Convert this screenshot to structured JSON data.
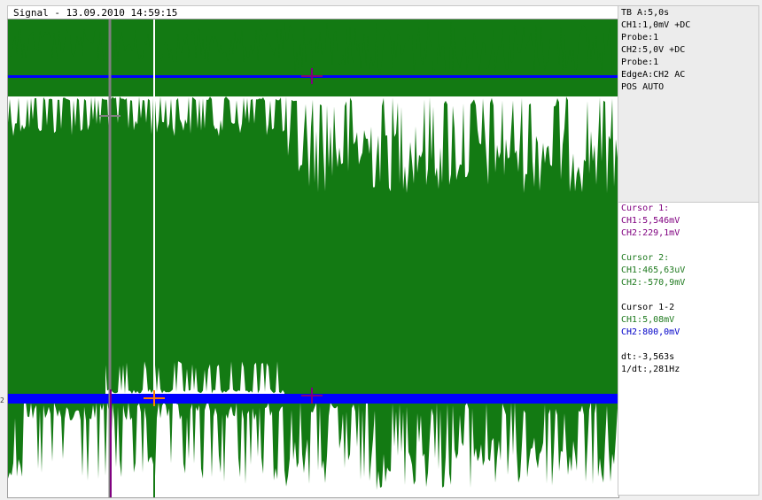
{
  "window": {
    "title": "Signal - 13.09.2010 14:59:15"
  },
  "settings": [
    "TB A:5,0s",
    "CH1:1,0mV +DC",
    "Probe:1",
    "CH2:5,0V +DC",
    "Probe:1",
    "EdgeA:CH2 AC",
    "POS AUTO"
  ],
  "cursors": {
    "cursor1": {
      "label": "Cursor 1:",
      "ch1": "CH1:5,546mV",
      "ch2": "CH2:229,1mV"
    },
    "cursor2": {
      "label": "Cursor 2:",
      "ch1": "CH1:465,63uV",
      "ch2": "CH2:-570,9mV"
    },
    "delta": {
      "label": "Cursor 1-2",
      "ch1": "CH1:5,08mV",
      "ch2": "CH2:800,0mV"
    },
    "dt": "dt:-3,563s",
    "inv_dt": "1/dt:,281Hz"
  },
  "channel_marker": "2",
  "colors": {
    "trace_ch1": "#137a13",
    "trace_ch2": "#0000ff",
    "band": "#fbf5d6",
    "cursor1": "#800080",
    "cursor2": "#137a13",
    "grid": "#a0a0a0"
  }
}
